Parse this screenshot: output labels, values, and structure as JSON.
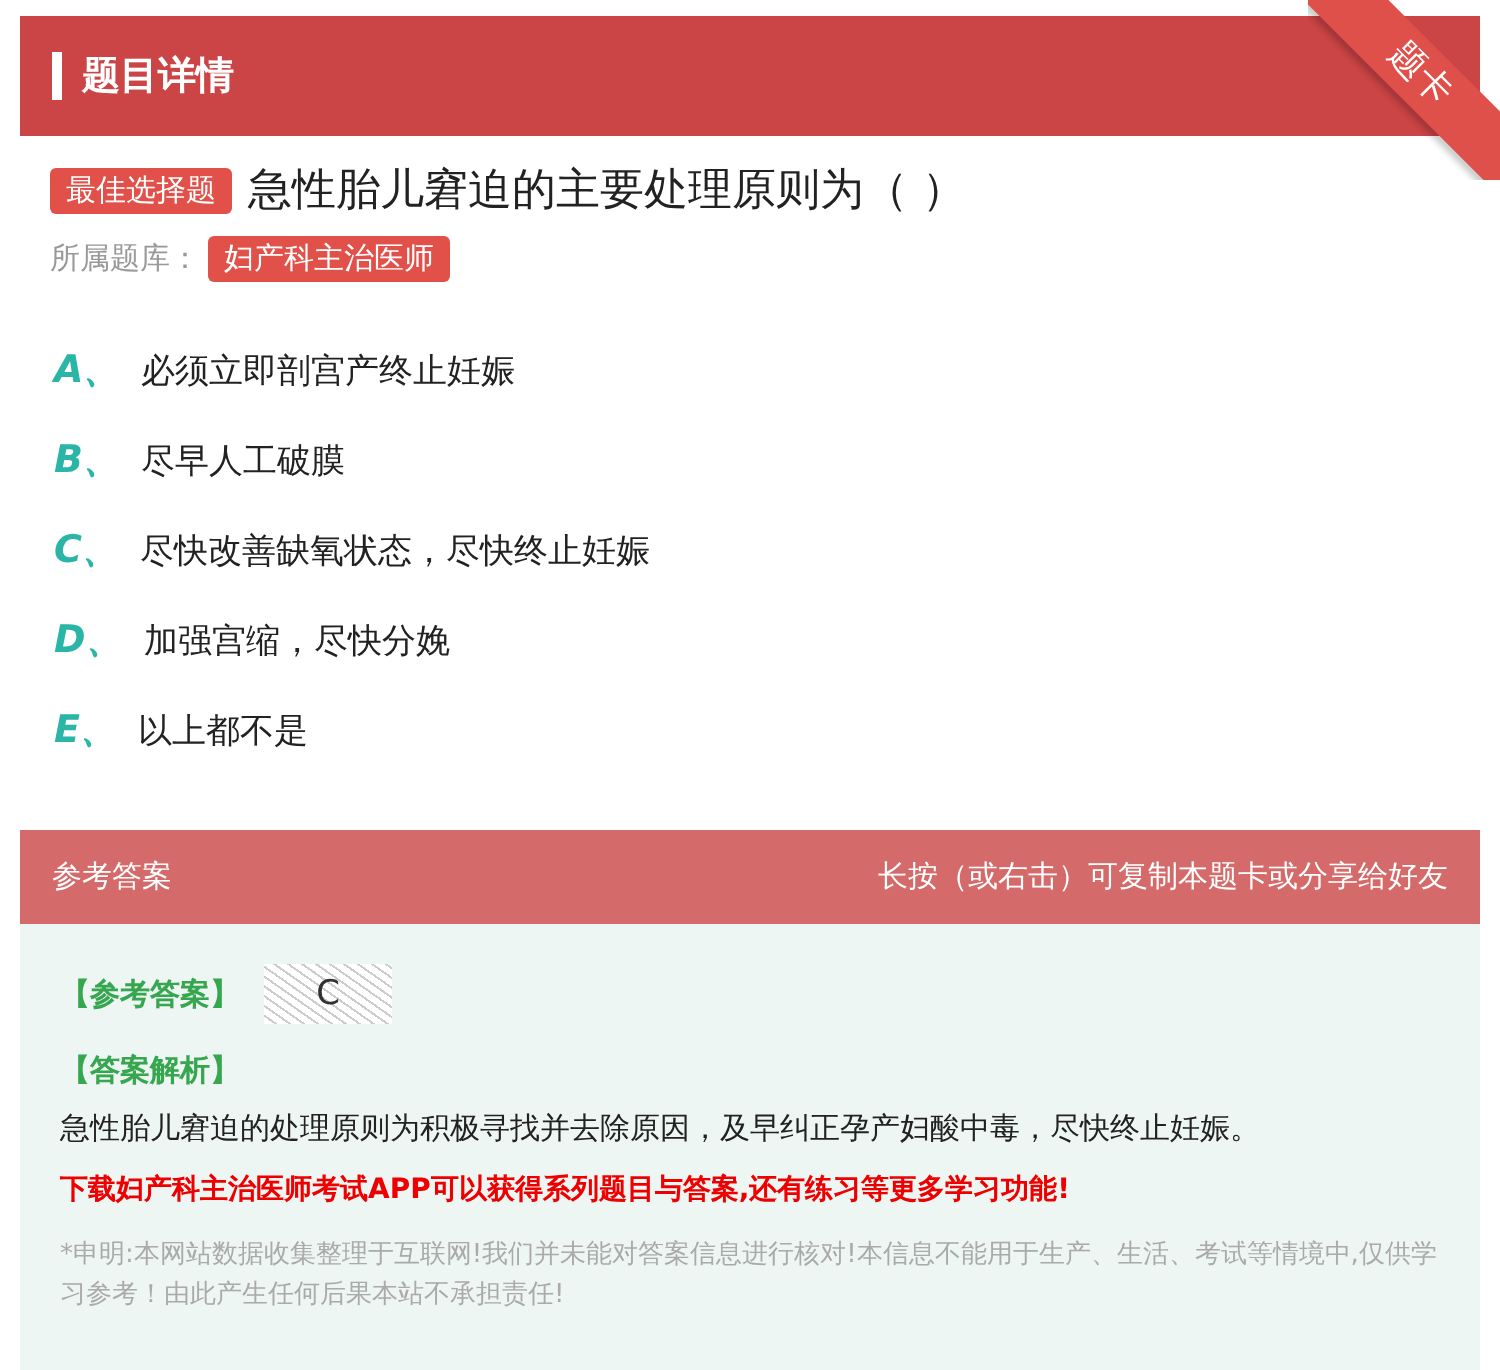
{
  "header": {
    "title": "题目详情",
    "ribbon": "题卡"
  },
  "question": {
    "type_badge": "最佳选择题",
    "text": "急性胎儿窘迫的主要处理原则为（ ）",
    "bank_label": "所属题库：",
    "bank": "妇产科主治医师"
  },
  "options": [
    {
      "letter": "A、",
      "text": "必须立即剖宫产终止妊娠"
    },
    {
      "letter": "B、",
      "text": "尽早人工破膜"
    },
    {
      "letter": "C、",
      "text": "尽快改善缺氧状态，尽快终止妊娠"
    },
    {
      "letter": "D、",
      "text": "加强宫缩，尽快分娩"
    },
    {
      "letter": "E、",
      "text": "以上都不是"
    }
  ],
  "answer_section": {
    "title": "参考答案",
    "hint": "长按（或右击）可复制本题卡或分享给好友",
    "answer_label": "【参考答案】",
    "answer": "C",
    "analysis_label": "【答案解析】",
    "analysis": "急性胎儿窘迫的处理原则为积极寻找并去除原因，及早纠正孕产妇酸中毒，尽快终止妊娠。",
    "promo": "下载妇产科主治医师考试APP可以获得系列题目与答案,还有练习等更多学习功能!",
    "disclaimer": "*申明:本网站数据收集整理于互联网!我们并未能对答案信息进行核对!本信息不能用于生产、生活、考试等情境中,仅供学习参考！由此产生任何后果本站不承担责任!"
  }
}
